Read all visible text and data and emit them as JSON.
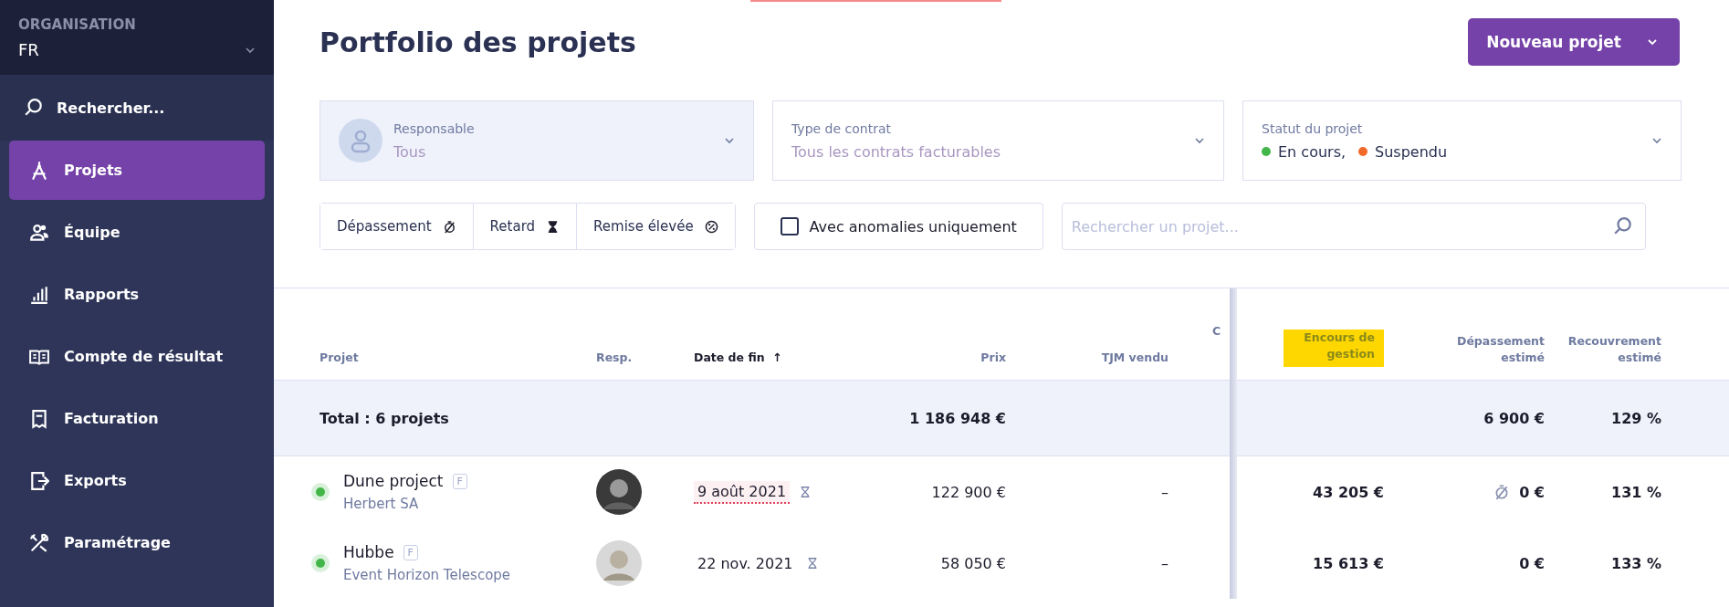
{
  "sidebar": {
    "org_label": "ORGANISATION",
    "org_value": "FR",
    "search": "Rechercher...",
    "items": [
      {
        "label": "Projets",
        "selected": true
      },
      {
        "label": "Équipe",
        "selected": false
      },
      {
        "label": "Rapports",
        "selected": false
      },
      {
        "label": "Compte de résultat",
        "selected": false
      },
      {
        "label": "Facturation",
        "selected": false
      },
      {
        "label": "Exports",
        "selected": false
      },
      {
        "label": "Paramétrage",
        "selected": false
      }
    ]
  },
  "page": {
    "title": "Portfolio des projets",
    "new_button": "Nouveau projet"
  },
  "filters": [
    {
      "kind": "person",
      "label": "Responsable",
      "value": "Tous"
    },
    {
      "kind": "plain",
      "label": "Type de contrat",
      "value": "Tous les contrats facturables"
    },
    {
      "kind": "status",
      "label": "Statut du projet",
      "statuses": [
        {
          "label": "En cours,",
          "color": "#43b649"
        },
        {
          "label": "Suspendu",
          "color": "#f26a2a"
        }
      ]
    }
  ],
  "toggles": [
    {
      "label": "Dépassement"
    },
    {
      "label": "Retard"
    },
    {
      "label": "Remise élevée"
    }
  ],
  "anomalies": {
    "label": "Avec anomalies uniquement",
    "checked": false
  },
  "search": {
    "placeholder": "Rechercher un projet..."
  },
  "table": {
    "columns": [
      {
        "label": "Projet",
        "sorted": false
      },
      {
        "label": "Resp.",
        "sorted": false
      },
      {
        "label": "Date de fin",
        "sorted": true,
        "sort_icon": "↑"
      },
      {
        "label": "Prix",
        "sorted": false
      },
      {
        "label": "TJM vendu",
        "sorted": false
      },
      {
        "label": "C",
        "sorted": false
      },
      {
        "label": "Encours de gestion",
        "sorted": false,
        "highlighted": true
      },
      {
        "label": "Dépassement estimé",
        "sorted": false
      },
      {
        "label": "Recouvrement estimé",
        "sorted": false
      }
    ],
    "total": {
      "label": "Total : 6 projets",
      "prix": "1 186 948 €",
      "depassement": "6 900 €",
      "recouvrement": "129 %"
    },
    "rows": [
      {
        "name": "Dune project",
        "badge": "F",
        "client": "Herbert SA",
        "color": "#43b649",
        "date": "9 août 2021",
        "late": true,
        "prix": "122 900 €",
        "tjm": "–",
        "encours": "43 205 €",
        "overrun": true,
        "depassement": "0 €",
        "recouvrement": "131 %"
      },
      {
        "name": "Hubbe",
        "badge": "F",
        "client": "Event Horizon Telescope",
        "color": "#43b649",
        "date": "22 nov. 2021",
        "late": false,
        "prix": "58 050 €",
        "tjm": "–",
        "encours": "15 613 €",
        "overrun": false,
        "depassement": "0 €",
        "recouvrement": "133 %"
      }
    ]
  }
}
